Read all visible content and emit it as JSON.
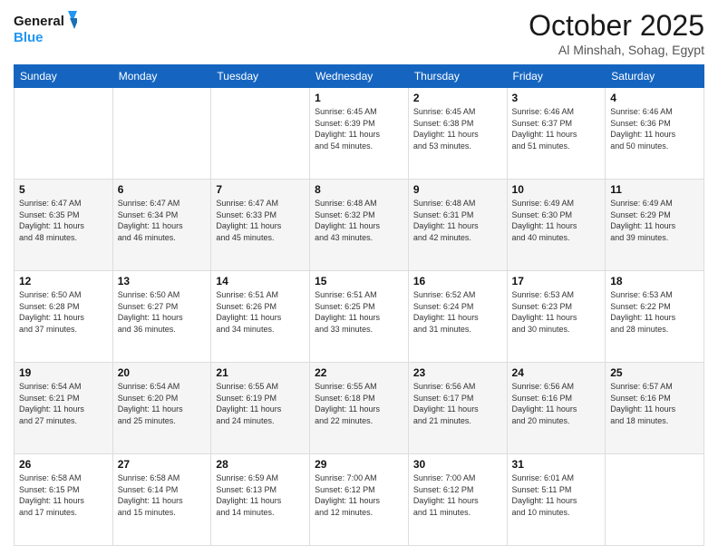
{
  "header": {
    "logo_line1": "General",
    "logo_line2": "Blue",
    "month_title": "October 2025",
    "location": "Al Minshah, Sohag, Egypt"
  },
  "days_of_week": [
    "Sunday",
    "Monday",
    "Tuesday",
    "Wednesday",
    "Thursday",
    "Friday",
    "Saturday"
  ],
  "weeks": [
    [
      {
        "day": "",
        "info": ""
      },
      {
        "day": "",
        "info": ""
      },
      {
        "day": "",
        "info": ""
      },
      {
        "day": "1",
        "info": "Sunrise: 6:45 AM\nSunset: 6:39 PM\nDaylight: 11 hours\nand 54 minutes."
      },
      {
        "day": "2",
        "info": "Sunrise: 6:45 AM\nSunset: 6:38 PM\nDaylight: 11 hours\nand 53 minutes."
      },
      {
        "day": "3",
        "info": "Sunrise: 6:46 AM\nSunset: 6:37 PM\nDaylight: 11 hours\nand 51 minutes."
      },
      {
        "day": "4",
        "info": "Sunrise: 6:46 AM\nSunset: 6:36 PM\nDaylight: 11 hours\nand 50 minutes."
      }
    ],
    [
      {
        "day": "5",
        "info": "Sunrise: 6:47 AM\nSunset: 6:35 PM\nDaylight: 11 hours\nand 48 minutes."
      },
      {
        "day": "6",
        "info": "Sunrise: 6:47 AM\nSunset: 6:34 PM\nDaylight: 11 hours\nand 46 minutes."
      },
      {
        "day": "7",
        "info": "Sunrise: 6:47 AM\nSunset: 6:33 PM\nDaylight: 11 hours\nand 45 minutes."
      },
      {
        "day": "8",
        "info": "Sunrise: 6:48 AM\nSunset: 6:32 PM\nDaylight: 11 hours\nand 43 minutes."
      },
      {
        "day": "9",
        "info": "Sunrise: 6:48 AM\nSunset: 6:31 PM\nDaylight: 11 hours\nand 42 minutes."
      },
      {
        "day": "10",
        "info": "Sunrise: 6:49 AM\nSunset: 6:30 PM\nDaylight: 11 hours\nand 40 minutes."
      },
      {
        "day": "11",
        "info": "Sunrise: 6:49 AM\nSunset: 6:29 PM\nDaylight: 11 hours\nand 39 minutes."
      }
    ],
    [
      {
        "day": "12",
        "info": "Sunrise: 6:50 AM\nSunset: 6:28 PM\nDaylight: 11 hours\nand 37 minutes."
      },
      {
        "day": "13",
        "info": "Sunrise: 6:50 AM\nSunset: 6:27 PM\nDaylight: 11 hours\nand 36 minutes."
      },
      {
        "day": "14",
        "info": "Sunrise: 6:51 AM\nSunset: 6:26 PM\nDaylight: 11 hours\nand 34 minutes."
      },
      {
        "day": "15",
        "info": "Sunrise: 6:51 AM\nSunset: 6:25 PM\nDaylight: 11 hours\nand 33 minutes."
      },
      {
        "day": "16",
        "info": "Sunrise: 6:52 AM\nSunset: 6:24 PM\nDaylight: 11 hours\nand 31 minutes."
      },
      {
        "day": "17",
        "info": "Sunrise: 6:53 AM\nSunset: 6:23 PM\nDaylight: 11 hours\nand 30 minutes."
      },
      {
        "day": "18",
        "info": "Sunrise: 6:53 AM\nSunset: 6:22 PM\nDaylight: 11 hours\nand 28 minutes."
      }
    ],
    [
      {
        "day": "19",
        "info": "Sunrise: 6:54 AM\nSunset: 6:21 PM\nDaylight: 11 hours\nand 27 minutes."
      },
      {
        "day": "20",
        "info": "Sunrise: 6:54 AM\nSunset: 6:20 PM\nDaylight: 11 hours\nand 25 minutes."
      },
      {
        "day": "21",
        "info": "Sunrise: 6:55 AM\nSunset: 6:19 PM\nDaylight: 11 hours\nand 24 minutes."
      },
      {
        "day": "22",
        "info": "Sunrise: 6:55 AM\nSunset: 6:18 PM\nDaylight: 11 hours\nand 22 minutes."
      },
      {
        "day": "23",
        "info": "Sunrise: 6:56 AM\nSunset: 6:17 PM\nDaylight: 11 hours\nand 21 minutes."
      },
      {
        "day": "24",
        "info": "Sunrise: 6:56 AM\nSunset: 6:16 PM\nDaylight: 11 hours\nand 20 minutes."
      },
      {
        "day": "25",
        "info": "Sunrise: 6:57 AM\nSunset: 6:16 PM\nDaylight: 11 hours\nand 18 minutes."
      }
    ],
    [
      {
        "day": "26",
        "info": "Sunrise: 6:58 AM\nSunset: 6:15 PM\nDaylight: 11 hours\nand 17 minutes."
      },
      {
        "day": "27",
        "info": "Sunrise: 6:58 AM\nSunset: 6:14 PM\nDaylight: 11 hours\nand 15 minutes."
      },
      {
        "day": "28",
        "info": "Sunrise: 6:59 AM\nSunset: 6:13 PM\nDaylight: 11 hours\nand 14 minutes."
      },
      {
        "day": "29",
        "info": "Sunrise: 7:00 AM\nSunset: 6:12 PM\nDaylight: 11 hours\nand 12 minutes."
      },
      {
        "day": "30",
        "info": "Sunrise: 7:00 AM\nSunset: 6:12 PM\nDaylight: 11 hours\nand 11 minutes."
      },
      {
        "day": "31",
        "info": "Sunrise: 6:01 AM\nSunset: 5:11 PM\nDaylight: 11 hours\nand 10 minutes."
      },
      {
        "day": "",
        "info": ""
      }
    ]
  ]
}
